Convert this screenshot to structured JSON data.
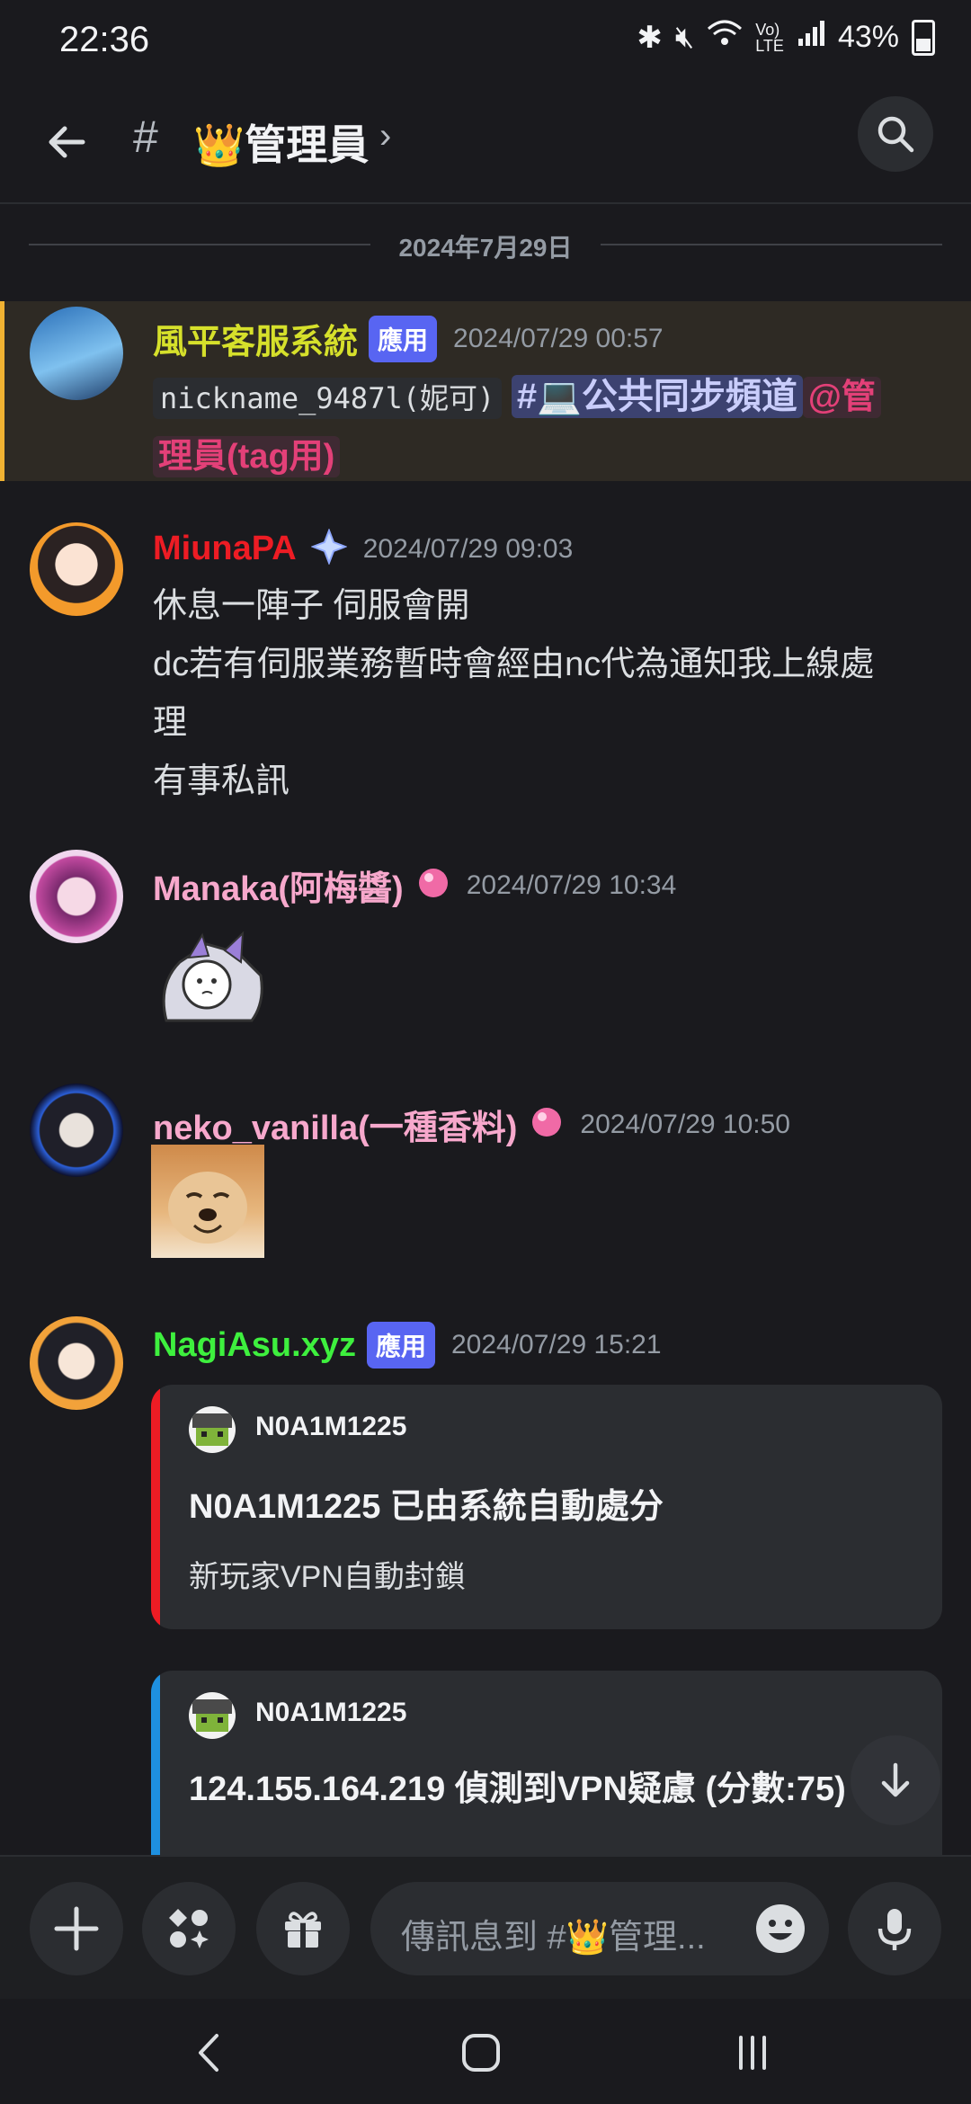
{
  "status": {
    "time": "22:36",
    "battery": "43%"
  },
  "header": {
    "hash": "#",
    "channel": "👑管理員",
    "chevron": "›"
  },
  "date_divider": "2024年7月29日",
  "messages": [
    {
      "author": "風平客服系統",
      "author_color": "#d6e02b",
      "badge": "應用",
      "timestamp": "2024/07/29 00:57",
      "code": "nickname_9487l(妮可)",
      "channel_mention": "#💻公共同步頻道",
      "role_mention_1": "@管",
      "role_mention_2": "理員(tag用)"
    },
    {
      "author": "MiunaPA",
      "author_color": "#ed1c24",
      "timestamp": "2024/07/29 09:03",
      "lines": [
        "休息一陣子 伺服會開",
        "dc若有伺服業務暫時會經由nc代為通知我上線處",
        "理",
        "有事私訊"
      ]
    },
    {
      "author": "Manaka(阿梅醬)",
      "author_color": "#f7a8cc",
      "timestamp": "2024/07/29 10:34"
    },
    {
      "author": "neko_vanilla(一種香料)",
      "author_color": "#f7a8cc",
      "timestamp": "2024/07/29 10:50"
    },
    {
      "author": "NagiAsu.xyz",
      "author_color": "#3ef03e",
      "badge": "應用",
      "timestamp": "2024/07/29 15:21",
      "embeds": [
        {
          "bar_color": "#ed1c24",
          "author": "N0A1M1225",
          "title": "N0A1M1225 已由系統自動處分",
          "description": "新玩家VPN自動封鎖"
        },
        {
          "bar_color": "#1e90e0",
          "author": "N0A1M1225",
          "title": "124.155.164.219 偵測到VPN疑慮 (分數:75)"
        }
      ]
    }
  ],
  "composer": {
    "placeholder": "傳訊息到 #👑管理..."
  },
  "icons": [
    "back-arrow-icon",
    "search-icon",
    "boost-icon",
    "plus-icon",
    "apps-icon",
    "gift-icon",
    "emoji-icon",
    "mic-icon",
    "chevron-down-icon"
  ]
}
